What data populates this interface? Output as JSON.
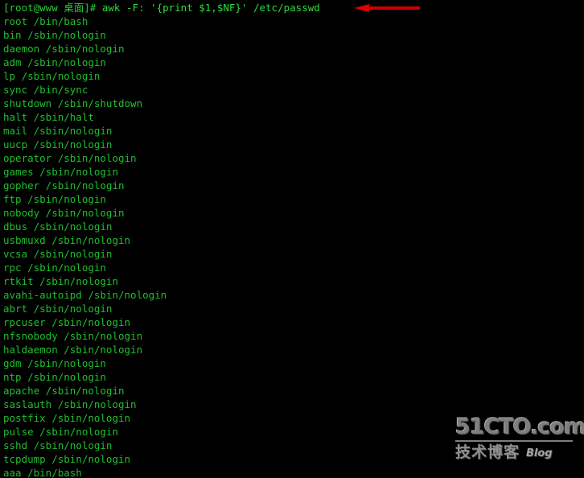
{
  "terminal": {
    "background_color": "#000000",
    "text_color": "#22cc33",
    "prompt": "[root@www 桌面]# ",
    "command": "awk -F: '{print $1,$NF}' /etc/passwd",
    "output_lines": [
      "root /bin/bash",
      "bin /sbin/nologin",
      "daemon /sbin/nologin",
      "adm /sbin/nologin",
      "lp /sbin/nologin",
      "sync /bin/sync",
      "shutdown /sbin/shutdown",
      "halt /sbin/halt",
      "mail /sbin/nologin",
      "uucp /sbin/nologin",
      "operator /sbin/nologin",
      "games /sbin/nologin",
      "gopher /sbin/nologin",
      "ftp /sbin/nologin",
      "nobody /sbin/nologin",
      "dbus /sbin/nologin",
      "usbmuxd /sbin/nologin",
      "vcsa /sbin/nologin",
      "rpc /sbin/nologin",
      "rtkit /sbin/nologin",
      "avahi-autoipd /sbin/nologin",
      "abrt /sbin/nologin",
      "rpcuser /sbin/nologin",
      "nfsnobody /sbin/nologin",
      "haldaemon /sbin/nologin",
      "gdm /sbin/nologin",
      "ntp /sbin/nologin",
      "apache /sbin/nologin",
      "saslauth /sbin/nologin",
      "postfix /sbin/nologin",
      "pulse /sbin/nologin",
      "sshd /sbin/nologin",
      "tcpdump /sbin/nologin",
      "aaa /bin/bash"
    ]
  },
  "annotation": {
    "arrow_color": "#cc0000",
    "arrow_direction": "left"
  },
  "watermark": {
    "site": "51CTO.com",
    "tagline": "技术博客",
    "blog_label": "Blog"
  }
}
